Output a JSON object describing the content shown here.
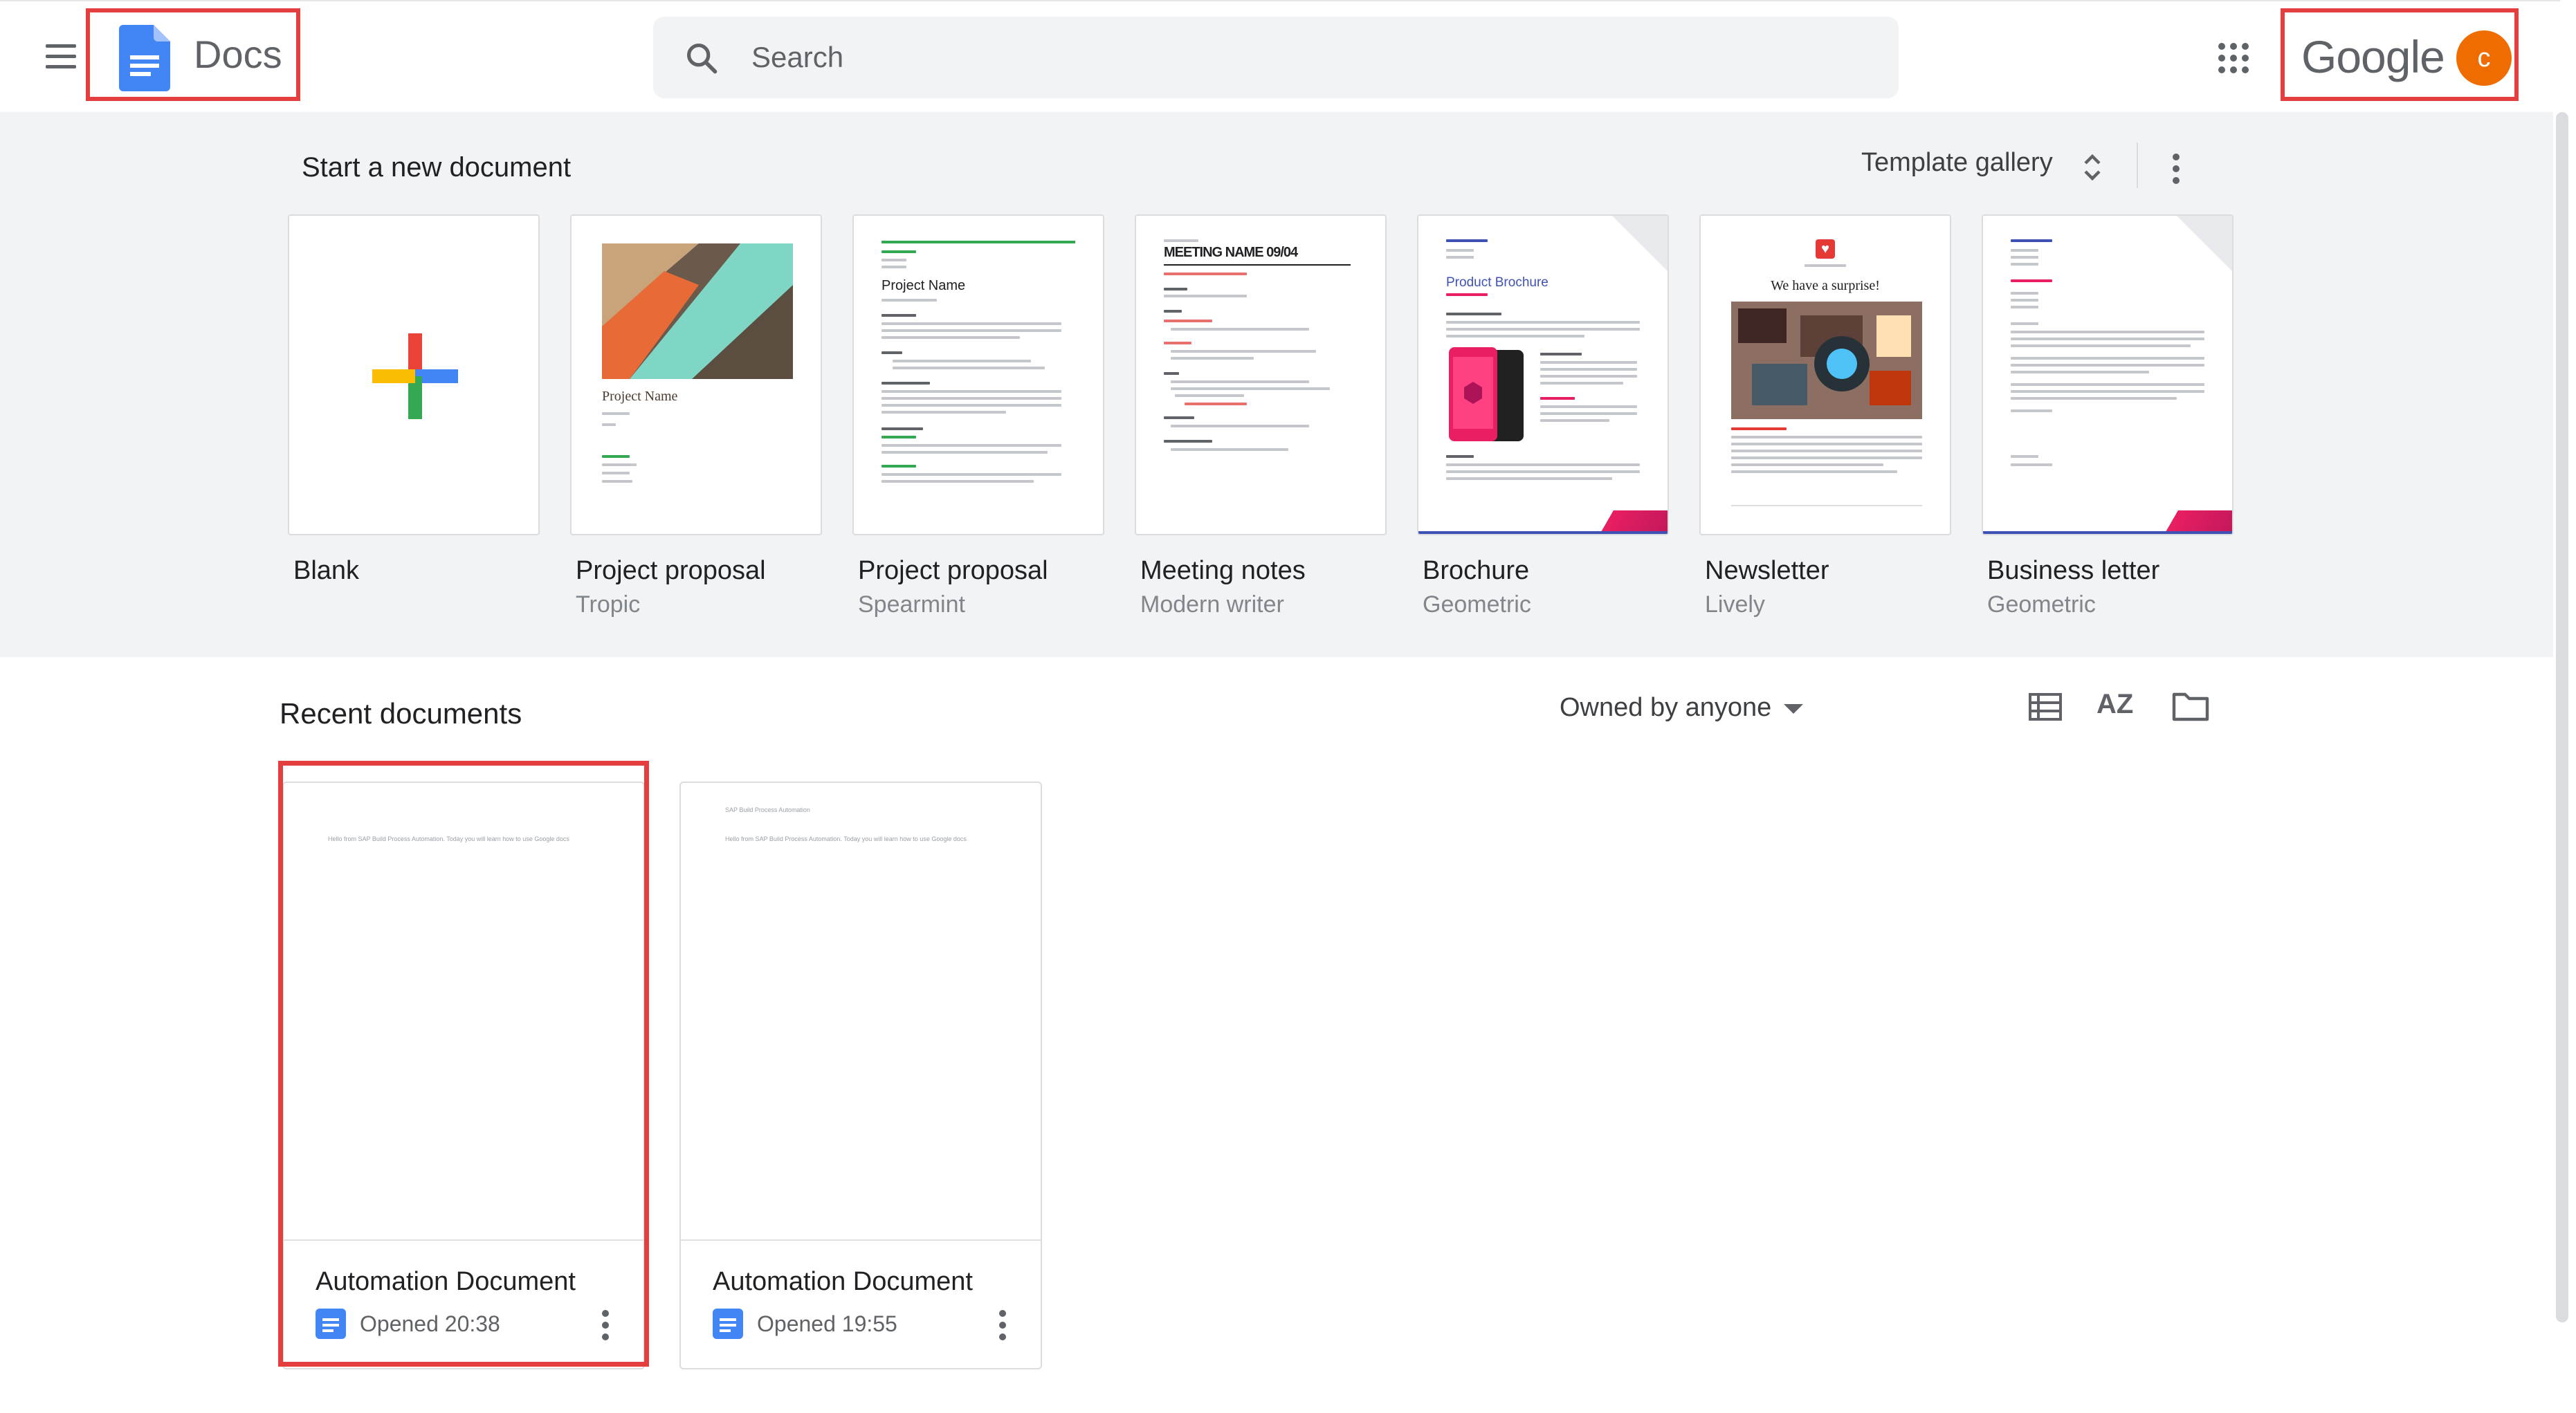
{
  "header": {
    "app_name": "Docs",
    "search_placeholder": "Search",
    "google_wordmark": "Google",
    "avatar_initial": "c"
  },
  "templates": {
    "section_title": "Start a new document",
    "gallery_label": "Template gallery",
    "items": [
      {
        "name": "Blank",
        "subtitle": ""
      },
      {
        "name": "Project proposal",
        "subtitle": "Tropic"
      },
      {
        "name": "Project proposal",
        "subtitle": "Spearmint"
      },
      {
        "name": "Meeting notes",
        "subtitle": "Modern writer"
      },
      {
        "name": "Brochure",
        "subtitle": "Geometric"
      },
      {
        "name": "Newsletter",
        "subtitle": "Lively"
      },
      {
        "name": "Business letter",
        "subtitle": "Geometric"
      }
    ],
    "thumb_text": {
      "tropic_title": "Project Name",
      "spearmint_title": "Project Name",
      "meeting_title": "MEETING NAME 09/04",
      "brochure_title": "Product Brochure",
      "newsletter_title": "We have a surprise!"
    }
  },
  "recent": {
    "section_title": "Recent documents",
    "owner_filter": "Owned by anyone",
    "sort_label": "AZ",
    "documents": [
      {
        "title": "Automation Document",
        "opened": "Opened 20:38",
        "preview_title": "",
        "preview_body": "Hello from SAP Build Process Automation. Today you will learn how to use Google docs"
      },
      {
        "title": "Automation Document",
        "opened": "Opened 19:55",
        "preview_title": "SAP Build Process Automation",
        "preview_body": "Hello from SAP Build Process Automation. Today you will learn how to use Google docs"
      }
    ]
  },
  "colors": {
    "highlight": "#e53e3e",
    "docs_blue": "#4285f4",
    "avatar": "#ef6c00",
    "section_bg": "#f1f3f4"
  },
  "icons": [
    "menu-icon",
    "docs-logo-icon",
    "search-icon",
    "apps-grid-icon",
    "sort-arrows-icon",
    "more-vert-icon",
    "list-view-icon",
    "sort-az-icon",
    "folder-icon"
  ]
}
